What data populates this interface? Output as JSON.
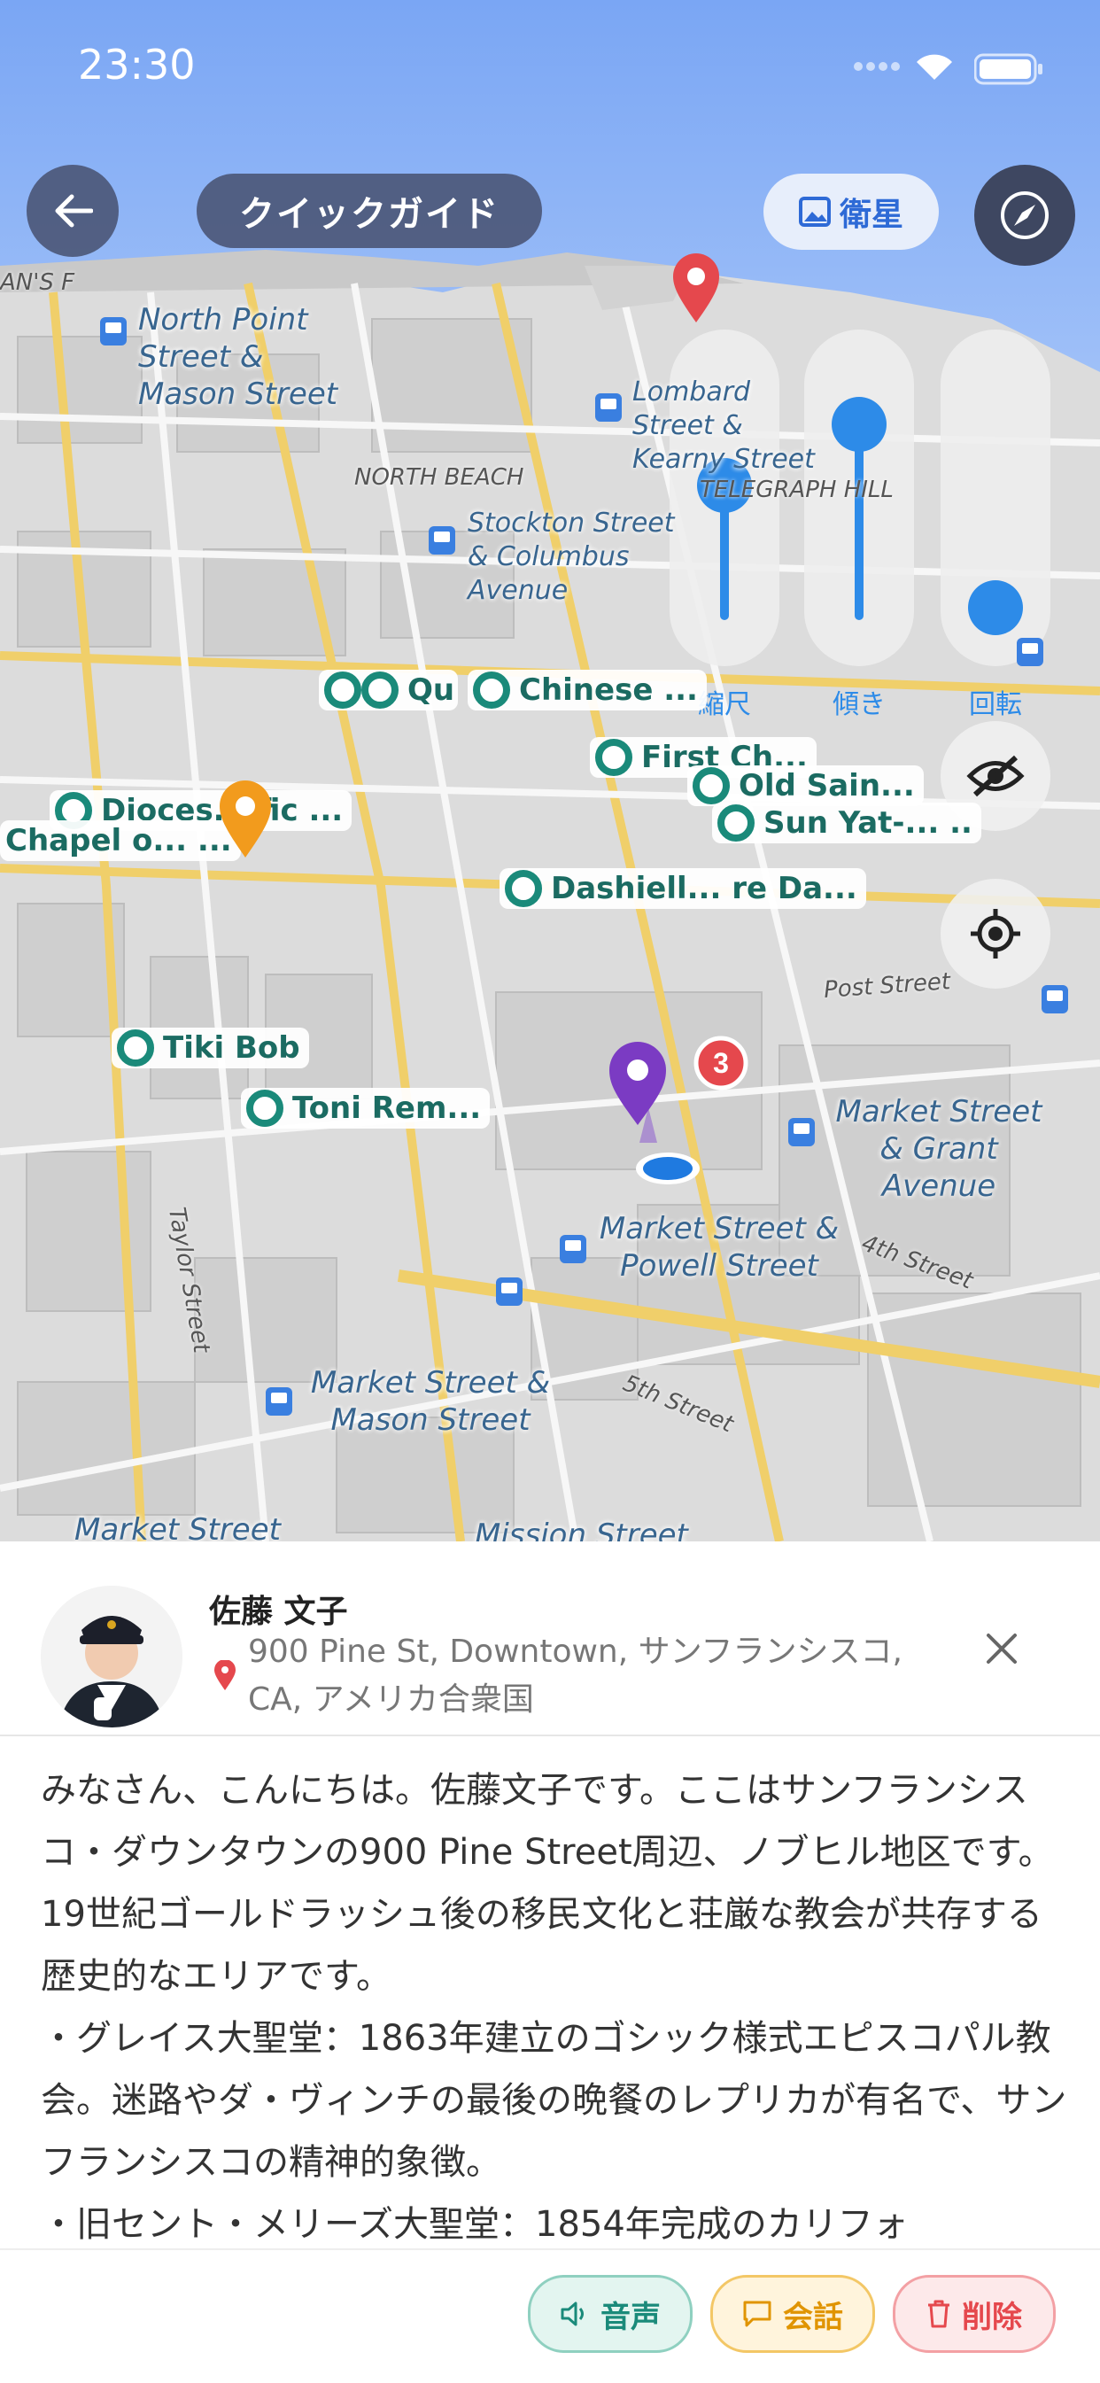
{
  "status": {
    "time": "23:30"
  },
  "header": {
    "guide_label": "クイックガイド",
    "satellite_label": "衛星"
  },
  "controls": {
    "zoom_label": "縮尺",
    "tilt_label": "傾き",
    "rotate_label": "回転",
    "zoom_value": 0.55,
    "tilt_value": 0.8,
    "rotate_value": 0.05
  },
  "map": {
    "pois": [
      "Qu",
      "Chinese ...",
      "First Ch...",
      "Old Sain...",
      "Sun Yat-... ..",
      "Dioces... fic ...",
      "Chapel o... ...",
      "Dashiell... re Da...",
      "Tiki Bob",
      "Toni Rem..."
    ],
    "stops": [
      "North Point Street & Mason Street",
      "Lombard Street & Kearny Street",
      "Stockton Street & Columbus Avenue",
      "Market Street & Grant Avenue",
      "Market Street & Powell Street",
      "Market Street & Mason Street",
      "Market Street",
      "Mission Street"
    ],
    "areas": [
      "NORTH BEACH",
      "TELEGRAPH HILL",
      "AN'S F"
    ],
    "streets": [
      "Taylor Street",
      "4th Street",
      "5th Street",
      "Post Street"
    ],
    "cluster_count": "3"
  },
  "guide": {
    "name": "佐藤 文子",
    "address": "900 Pine St, Downtown, サンフランシスコ, CA, アメリカ合衆国",
    "paragraphs": [
      "みなさん、こんにちは。佐藤文子です。ここはサンフランシスコ・ダウンタウンの900 Pine Street周辺、ノブヒル地区です。19世紀ゴールドラッシュ後の移民文化と荘厳な教会が共存する歴史的なエリアです。",
      "・グレイス大聖堂：1863年建立のゴシック様式エピスコパル教会。迷路やダ・ヴィンチの最後の晩餐のレプリカが有名で、サンフランシスコの精神的象徴。",
      "・旧セント・メリーズ大聖堂：1854年完成のカリフォ"
    ]
  },
  "actions": {
    "audio_label": "音声",
    "chat_label": "会話",
    "delete_label": "削除"
  },
  "colors": {
    "accent": "#2d8be8",
    "teal": "#1a8a7a",
    "chat": "#f0a500",
    "delete": "#e5484d"
  }
}
